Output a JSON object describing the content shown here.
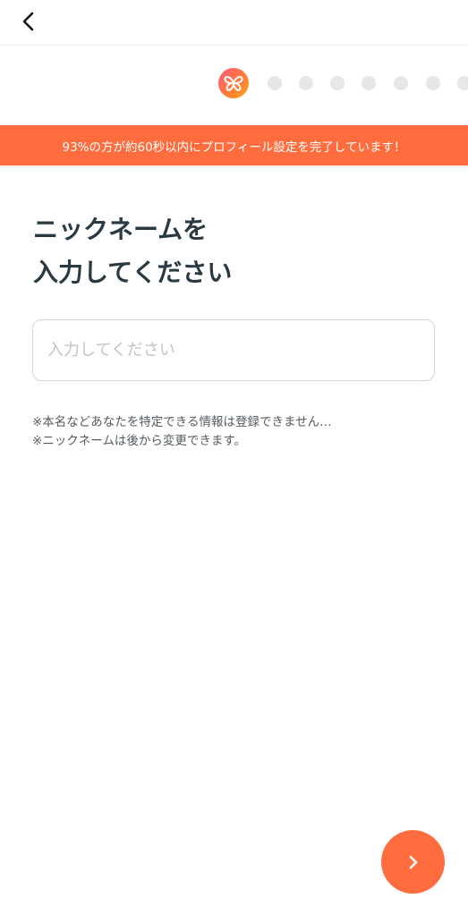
{
  "header": {
    "back_icon": "chevron-left-icon"
  },
  "progress": {
    "logo_icon": "butterfly-logo-icon",
    "current_step": 1,
    "total_steps": 8,
    "active_color": "#ff6d3f",
    "inactive_color": "#e7e7e7"
  },
  "banner": {
    "text": "93%の方が約60秒以内にプロフィール設定を完了しています！",
    "background_color": "#ff6d3f"
  },
  "title": {
    "line1": "ニックネームを",
    "line2": "入力してください"
  },
  "nickname_input": {
    "value": "",
    "placeholder": "入力してください"
  },
  "notes": {
    "line1": "※本名などあなたを特定できる情報は登録できません…",
    "line2": "※ニックネームは後から変更できます。"
  },
  "next_button": {
    "icon": "chevron-right-icon",
    "color": "#ff6d3f"
  }
}
